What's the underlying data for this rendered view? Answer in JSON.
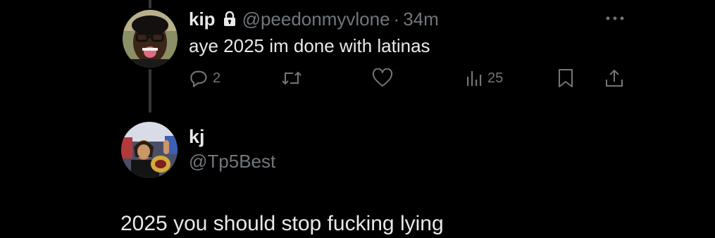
{
  "colors": {
    "background": "#000000",
    "primary_text": "#e7e9ea",
    "secondary_text": "#71767b",
    "thread_line": "#333639"
  },
  "reply_tweet": {
    "display_name": "kip",
    "protected_icon": "lock-icon",
    "handle": "@peedonmyvlone",
    "separator": "·",
    "time": "34m",
    "text": "aye 2025 im done with latinas",
    "more_icon": "more-horizontal-icon",
    "actions": {
      "reply": {
        "icon": "reply-icon",
        "count": "2"
      },
      "retweet": {
        "icon": "retweet-icon",
        "count": ""
      },
      "like": {
        "icon": "heart-icon",
        "count": ""
      },
      "views": {
        "icon": "views-icon",
        "count": "25"
      },
      "bookmark": {
        "icon": "bookmark-icon"
      },
      "share": {
        "icon": "share-icon"
      }
    }
  },
  "main_tweet": {
    "display_name": "kj",
    "handle": "@Tp5Best",
    "text": "2025 you should stop fucking lying"
  }
}
